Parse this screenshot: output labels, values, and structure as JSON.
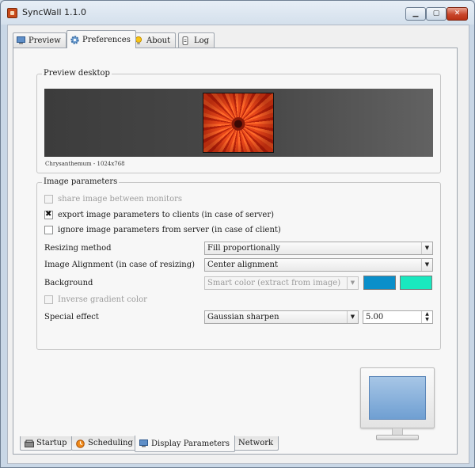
{
  "window": {
    "title": "SyncWall 1.1.0",
    "controls": {
      "minimize": "▁",
      "maximize": "▢",
      "close": "✕"
    }
  },
  "top_tabs": [
    {
      "label": "Preview",
      "icon": "monitor-icon",
      "active": false
    },
    {
      "label": "Preferences",
      "icon": "gear-icon",
      "active": true
    },
    {
      "label": "About",
      "icon": "lightbulb-icon",
      "active": false
    },
    {
      "label": "Log",
      "icon": "log-icon",
      "active": false
    }
  ],
  "preview_desktop": {
    "legend": "Preview  desktop",
    "caption": "Chrysanthemum - 1024x768"
  },
  "image_parameters": {
    "legend": "Image parameters",
    "checkboxes": [
      {
        "label": "share image between monitors",
        "checked": false,
        "enabled": false
      },
      {
        "label": "export image parameters to clients (in case of server)",
        "checked": true,
        "enabled": true
      },
      {
        "label": "ignore image parameters from server (in case of client)",
        "checked": false,
        "enabled": true
      }
    ],
    "resizing_method": {
      "label": "Resizing method",
      "value": "Fill proportionally"
    },
    "image_alignment": {
      "label": "Image Alignment (in case of resizing)",
      "value": "Center alignment"
    },
    "background": {
      "label": "Background",
      "value": "Smart color (extract from image)",
      "color1": "#0a8fca",
      "color2": "#19e8bf"
    },
    "inverse_gradient": {
      "label": "Inverse gradient color",
      "checked": false,
      "enabled": false
    },
    "special_effect": {
      "label": "Special effect",
      "value": "Gaussian sharpen",
      "amount": "5.00"
    }
  },
  "bottom_tabs": [
    {
      "label": "Startup",
      "icon": "startup-icon",
      "active": false
    },
    {
      "label": "Scheduling",
      "icon": "clock-icon",
      "active": false
    },
    {
      "label": "Display Parameters",
      "icon": "monitor-icon",
      "active": true
    },
    {
      "label": "Network",
      "icon": "globe-icon",
      "active": false
    }
  ]
}
